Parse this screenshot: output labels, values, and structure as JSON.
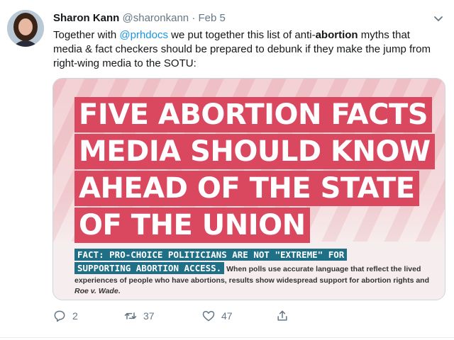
{
  "tweet": {
    "author_name": "Sharon Kann",
    "handle": "@sharonkann",
    "separator": "·",
    "date": "Feb 5",
    "text": {
      "part1": "Together with ",
      "mention": "@prhdocs",
      "part2": " we put together this list of anti-",
      "bold_word": "abortion",
      "part3": " myths that media & fact checkers should be prepared to debunk if they make the jump from right-wing media to the SOTU:"
    }
  },
  "card": {
    "headline_lines": [
      "FIVE ABORTION FACTS",
      "MEDIA SHOULD KNOW",
      "AHEAD OF THE STATE",
      "OF THE UNION"
    ],
    "fact_strip_1": "FACT: PRO-CHOICE POLITICIANS ARE NOT \"EXTREME\" FOR",
    "fact_strip_2": "SUPPORTING ABORTION ACCESS.",
    "fact_body_1": " When polls use accurate language that reflect the lived experiences of people who have abortions, results show widespread support for abortion rights and ",
    "fact_body_italic": "Roe v. Wade",
    "fact_body_end": "."
  },
  "actions": {
    "reply_count": "2",
    "retweet_count": "37",
    "like_count": "47"
  },
  "colors": {
    "headline_bg": "#d9485f",
    "fact_strip_bg": "#1f6f86",
    "link": "#1b95e0",
    "secondary_text": "#657786"
  },
  "icons": [
    "reply-icon",
    "retweet-icon",
    "like-icon",
    "share-icon",
    "caret-down-icon"
  ]
}
